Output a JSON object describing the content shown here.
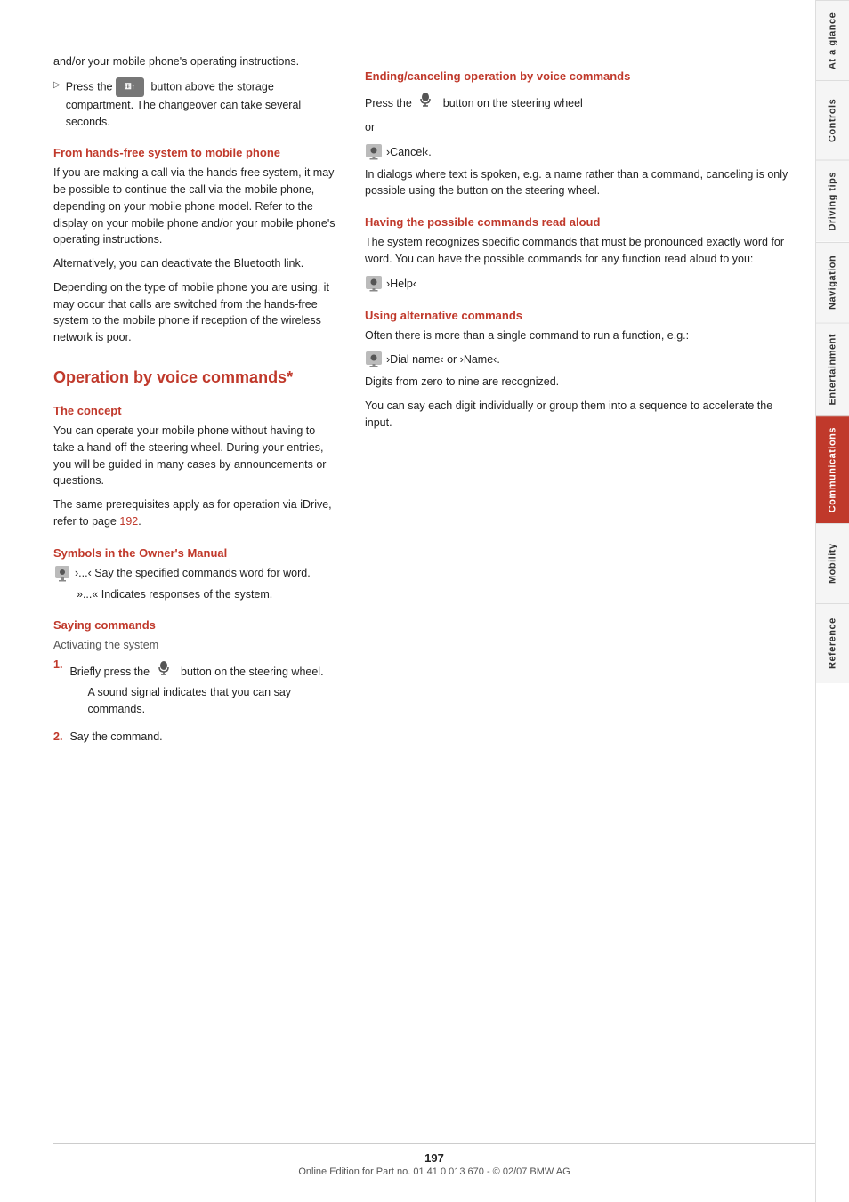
{
  "page": {
    "number": "197",
    "footer": "Online Edition for Part no. 01 41 0 013 670 - © 02/07 BMW AG"
  },
  "sidebar": {
    "tabs": [
      {
        "id": "at-a-glance",
        "label": "At a glance",
        "active": false
      },
      {
        "id": "controls",
        "label": "Controls",
        "active": false
      },
      {
        "id": "driving-tips",
        "label": "Driving tips",
        "active": false
      },
      {
        "id": "navigation",
        "label": "Navigation",
        "active": false
      },
      {
        "id": "entertainment",
        "label": "Entertainment",
        "active": false
      },
      {
        "id": "communications",
        "label": "Communications",
        "active": true
      },
      {
        "id": "mobility",
        "label": "Mobility",
        "active": false
      },
      {
        "id": "reference",
        "label": "Reference",
        "active": false
      }
    ]
  },
  "left_column": {
    "intro_text": "and/or your mobile phone's operating instructions.",
    "press_button_text": "Press the",
    "press_button_suffix": "button above the storage compartment. The changeover can take several seconds.",
    "from_hands_free": {
      "heading": "From hands-free system to mobile phone",
      "para1": "If you are making a call via the hands-free system, it may be possible to continue the call via the mobile phone, depending on your mobile phone model. Refer to the display on your mobile phone and/or your mobile phone's operating instructions.",
      "para2": "Alternatively, you can deactivate the Bluetooth link.",
      "para3": "Depending on the type of mobile phone you are using, it may occur that calls are switched from the hands-free system to the mobile phone if reception of the wireless network is poor."
    },
    "operation_heading": "Operation by voice commands*",
    "concept": {
      "heading": "The concept",
      "para1": "You can operate your mobile phone without having to take a hand off the steering wheel. During your entries, you will be guided in many cases by announcements or questions.",
      "para2": "The same prerequisites apply as for operation via iDrive, refer to page",
      "page_link": "192",
      "para2_suffix": "."
    },
    "symbols": {
      "heading": "Symbols in the Owner's Manual",
      "line1_prefix": "›...‹ Say the specified commands word for word.",
      "line2": "»...« Indicates responses of the system."
    },
    "saying_commands": {
      "heading": "Saying commands",
      "activating": {
        "subheading": "Activating the system",
        "step1": "Briefly press the",
        "step1_suffix": "button on the steering wheel.",
        "step1_sub": "A sound signal indicates that you can say commands.",
        "step2": "Say the command."
      }
    }
  },
  "right_column": {
    "ending": {
      "heading": "Ending/canceling operation by voice commands",
      "para1": "Press the",
      "para1_suffix": "button on the steering wheel",
      "or_text": "or",
      "command": "›Cancel‹.",
      "para2": "In dialogs where text is spoken, e.g. a name rather than a command, canceling is only possible using the button on the steering wheel."
    },
    "having_commands": {
      "heading": "Having the possible commands read aloud",
      "para1": "The system recognizes specific commands that must be pronounced exactly word for word. You can have the possible commands for any function read aloud to you:",
      "command": "›Help‹"
    },
    "alternative": {
      "heading": "Using alternative commands",
      "para1": "Often there is more than a single command to run a function, e.g.:",
      "command": "›Dial name‹ or ›Name‹.",
      "para2": "Digits from zero to nine are recognized.",
      "para3": "You can say each digit individually or group them into a sequence to accelerate the input."
    }
  }
}
